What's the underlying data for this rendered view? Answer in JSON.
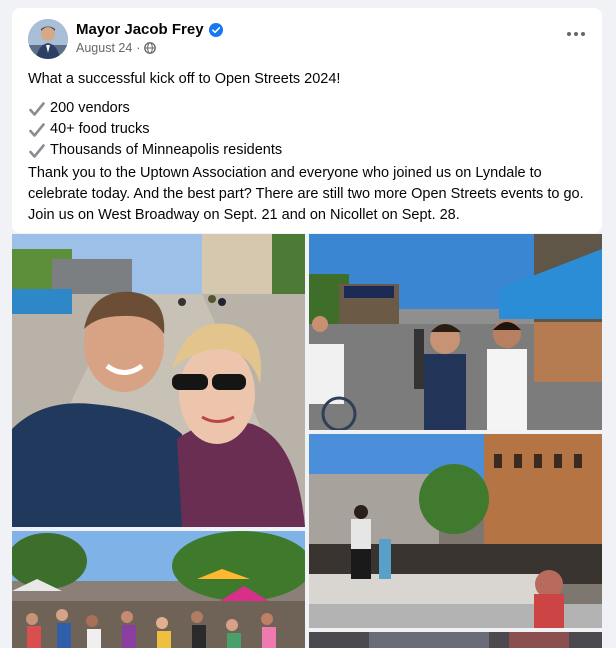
{
  "post": {
    "author": "Mayor Jacob Frey",
    "date": "August 24",
    "separator": "·",
    "intro": "What a successful kick off to Open Streets 2024!",
    "bullets": [
      "200 vendors",
      "40+ food trucks",
      "Thousands of Minneapolis residents"
    ],
    "body": "Thank you to the Uptown Association and everyone who joined us on Lyndale to celebrate today. And the best part? There are still two more Open Streets events to go. Join us on West Broadway on Sept. 21 and on Nicollet on Sept. 28."
  },
  "icons": {
    "verified": "verified-badge-icon",
    "privacy": "globe-icon",
    "menu": "more-options-icon",
    "bullet": "check-mark-icon"
  },
  "colors": {
    "background": "#f0f2f5",
    "card": "#ffffff",
    "text": "#050505",
    "secondary": "#65676b",
    "verified": "#1877f2"
  },
  "photos": [
    "selfie-photo",
    "tent-street-photo",
    "stage-photo",
    "crowd-photo",
    "partial-photo"
  ]
}
